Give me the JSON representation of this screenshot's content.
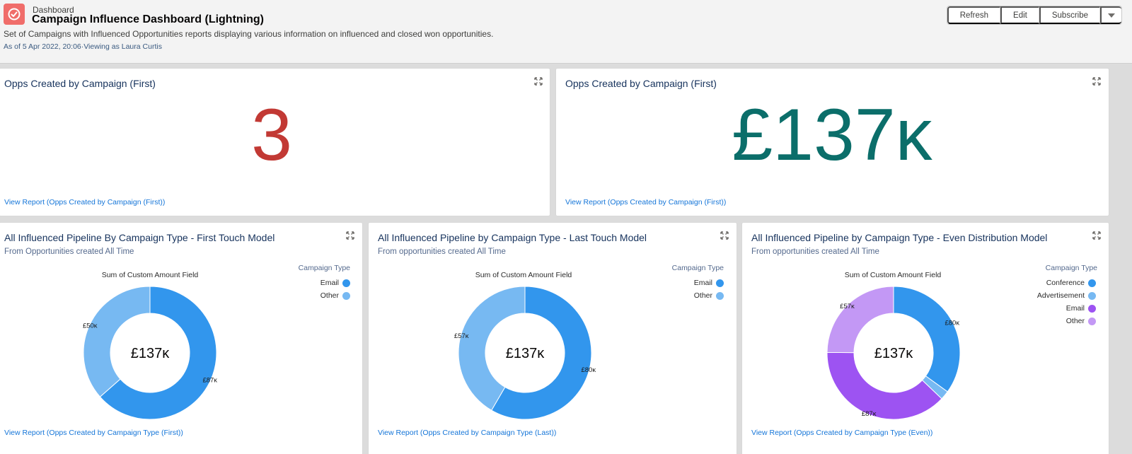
{
  "header": {
    "eyebrow": "Dashboard",
    "title": "Campaign Influence Dashboard (Lightning)",
    "description": "Set of Campaigns with Influenced Opportunities reports displaying various information on influenced and closed won opportunities.",
    "as_of": "As of 5 Apr 2022, 20:06·Viewing as Laura Curtis",
    "buttons": {
      "refresh": "Refresh",
      "edit": "Edit",
      "subscribe": "Subscribe"
    },
    "icon": "dashboard-gauge-icon",
    "icon_color": "#f06d6a"
  },
  "metrics": [
    {
      "title": "Opps Created by Campaign (First)",
      "value": "3",
      "color": "#c23934",
      "link": "View Report (Opps Created by Campaign (First))"
    },
    {
      "title": "Opps Created by Campaign (First)",
      "value": "£137ĸ",
      "color": "#0b6e6a",
      "link": "View Report (Opps Created by Campaign (First))"
    }
  ],
  "donuts": [
    {
      "title": "All Influenced Pipeline By Campaign Type - First Touch Model",
      "subtitle": "From Opportunities created All Time",
      "chart_title": "Sum of Custom Amount Field",
      "legend_title": "Campaign Type",
      "center": "£137ĸ",
      "link": "View Report (Opps Created by Campaign Type (First))",
      "legend": [
        {
          "label": "Email",
          "color": "#3296ed"
        },
        {
          "label": "Other",
          "color": "#77b9f2"
        }
      ]
    },
    {
      "title": "All Influenced Pipeline by Campaign Type - Last Touch Model",
      "subtitle": "From opportunities created All Time",
      "chart_title": "Sum of Custom Amount Field",
      "legend_title": "Campaign Type",
      "center": "£137ĸ",
      "link": "View Report (Opps Created by Campaign Type (Last))",
      "legend": [
        {
          "label": "Email",
          "color": "#3296ed"
        },
        {
          "label": "Other",
          "color": "#77b9f2"
        }
      ]
    },
    {
      "title": "All Influenced Pipeline by Campaign Type - Even Distribution Model",
      "subtitle": "From opportunities created All Time",
      "chart_title": "Sum of Custom Amount Field",
      "legend_title": "Campaign Type",
      "center": "£137ĸ",
      "link": "View Report (Opps Created by Campaign Type (Even))",
      "legend": [
        {
          "label": "Conference",
          "color": "#3296ed"
        },
        {
          "label": "Advertisement",
          "color": "#77b9f2"
        },
        {
          "label": "Email",
          "color": "#9d53f2"
        },
        {
          "label": "Other",
          "color": "#c398f5"
        }
      ]
    }
  ],
  "chart_data": [
    {
      "type": "pie",
      "title": "Sum of Custom Amount Field",
      "total_label": "£137ĸ",
      "categories": [
        "Email",
        "Other"
      ],
      "values": [
        87,
        50
      ],
      "value_labels": [
        "£87ĸ",
        "£50ĸ"
      ],
      "colors": [
        "#3296ed",
        "#77b9f2"
      ],
      "legend_title": "Campaign Type",
      "legend_position": "top-right"
    },
    {
      "type": "pie",
      "title": "Sum of Custom Amount Field",
      "total_label": "£137ĸ",
      "categories": [
        "Email",
        "Other"
      ],
      "values": [
        80,
        57
      ],
      "value_labels": [
        "£80ĸ",
        "£57ĸ"
      ],
      "colors": [
        "#3296ed",
        "#77b9f2"
      ],
      "legend_title": "Campaign Type",
      "legend_position": "top-right"
    },
    {
      "type": "pie",
      "title": "Sum of Custom Amount Field",
      "total_label": "£137ĸ",
      "categories": [
        "Conference",
        "Advertisement",
        "Email",
        "Other"
      ],
      "values": [
        80,
        5,
        87,
        57
      ],
      "value_labels": [
        "£80ĸ",
        "",
        "£87ĸ",
        "£57ĸ"
      ],
      "colors": [
        "#3296ed",
        "#77b9f2",
        "#9d53f2",
        "#c398f5"
      ],
      "legend_title": "Campaign Type",
      "legend_position": "top-right"
    }
  ]
}
